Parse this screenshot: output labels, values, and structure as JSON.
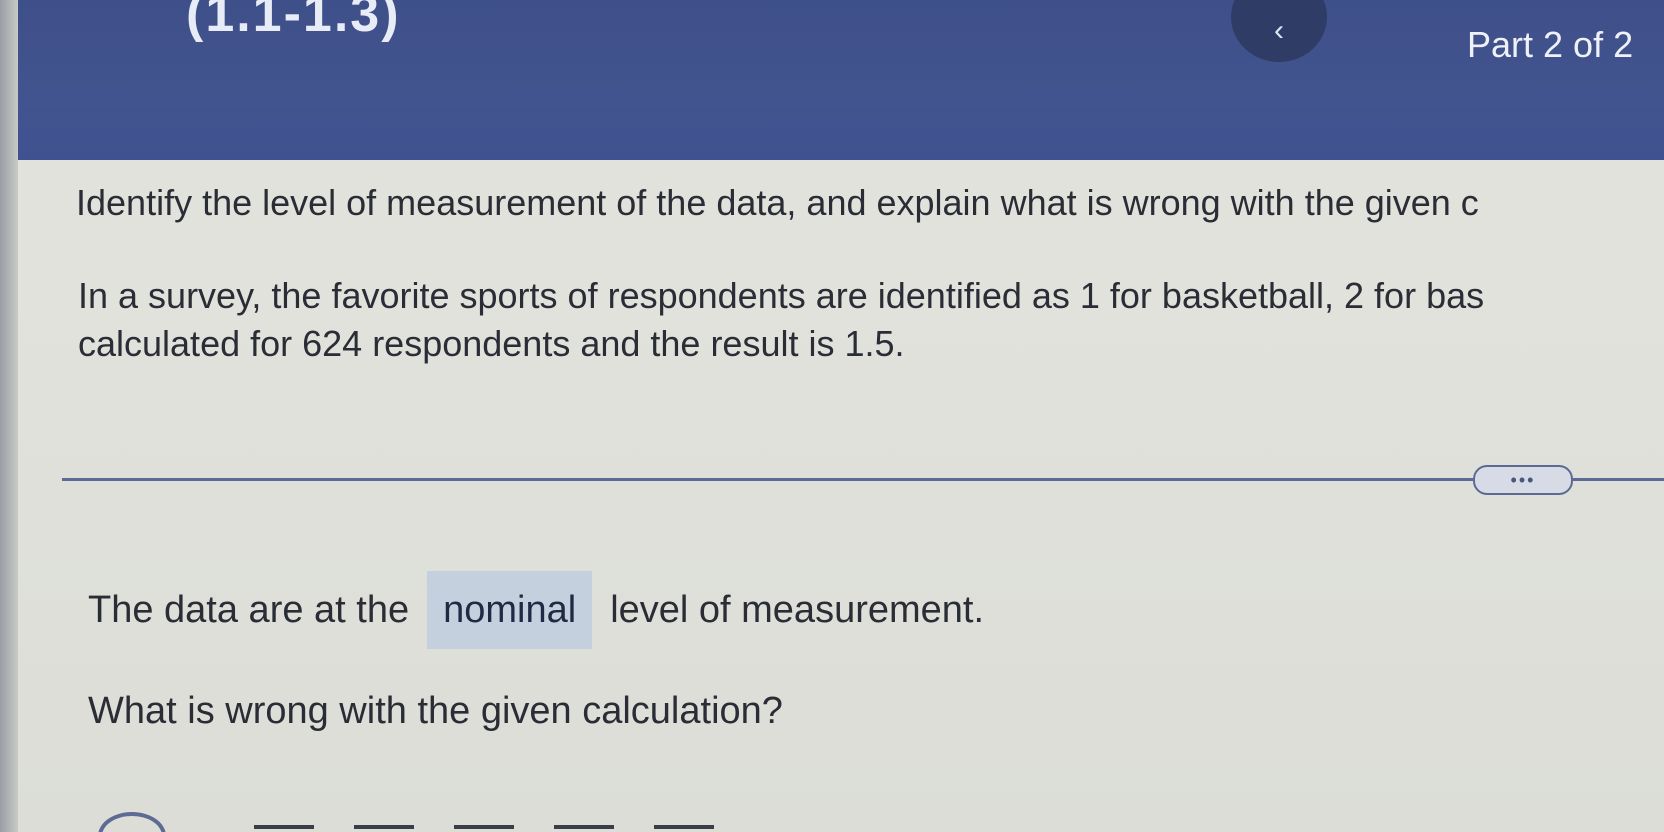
{
  "header": {
    "title": "(1.1-1.3)",
    "back_icon": "chevron-left-icon",
    "part_label": "Part 2 of 2"
  },
  "question": {
    "instruction": "Identify the level of measurement of the data, and explain what is wrong with the given c",
    "problem_line1": "In a survey, the favorite sports of respondents are identified as 1 for basketball, 2 for bas",
    "problem_line2": "calculated for 624 respondents and the result is 1.5."
  },
  "more_button": {
    "label": "•••"
  },
  "answer": {
    "prefix": "The data are at the",
    "selected_value": "nominal",
    "suffix": "level of measurement."
  },
  "followup": {
    "question": "What is wrong with the given calculation?"
  },
  "colors": {
    "header_bg": "#42548f",
    "answer_box_bg": "#c5d0de",
    "divider": "#5c6a94"
  }
}
